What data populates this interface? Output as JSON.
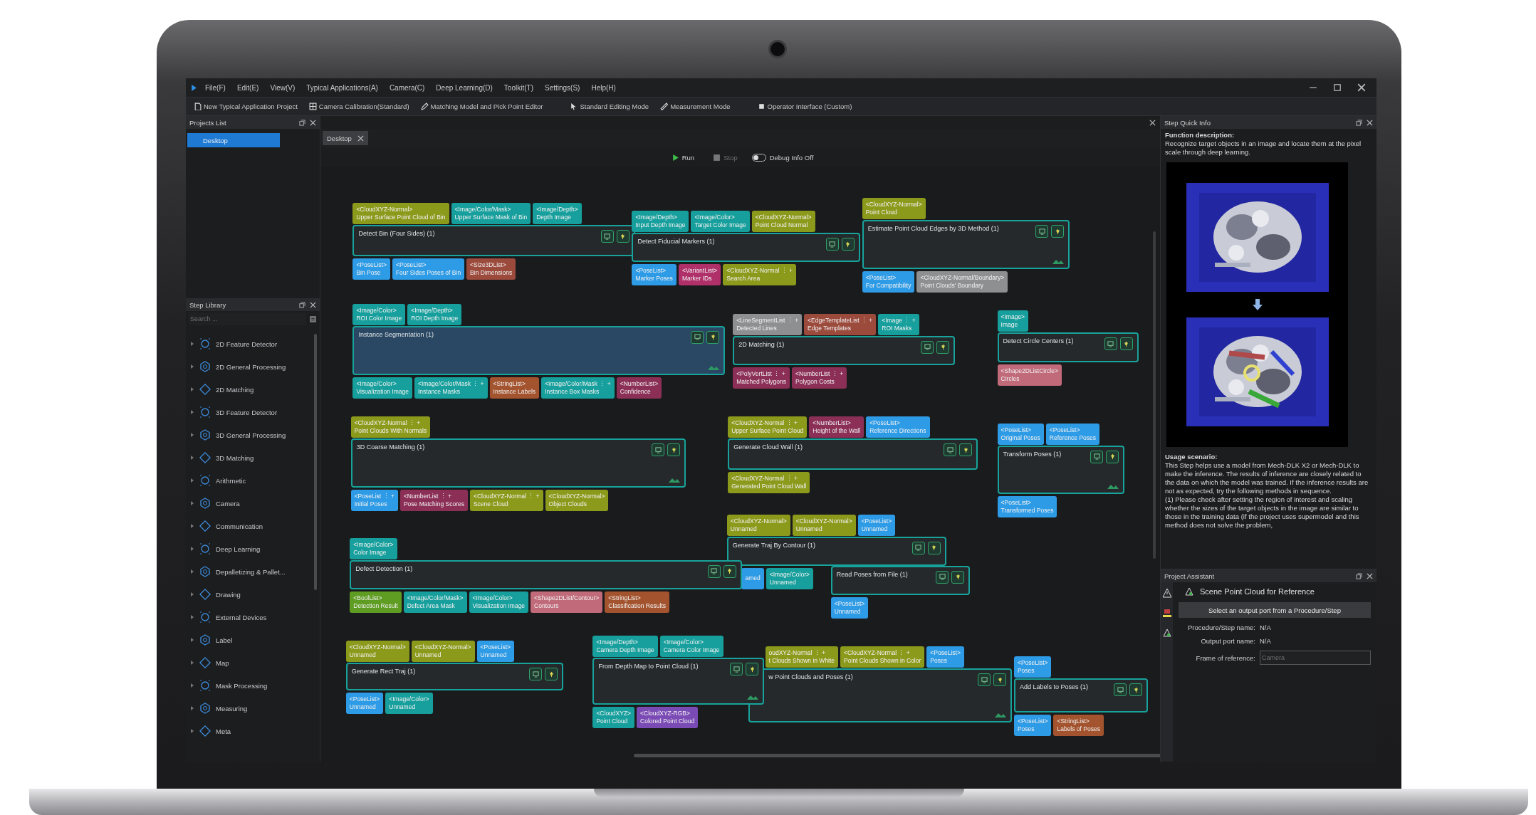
{
  "menu": [
    "File(F)",
    "Edit(E)",
    "View(V)",
    "Typical Applications(A)",
    "Camera(C)",
    "Deep Learning(D)",
    "Toolkit(T)",
    "Settings(S)",
    "Help(H)"
  ],
  "toolbar": [
    {
      "label": "New Typical Application Project",
      "kind": "project"
    },
    {
      "label": "Camera Calibration(Standard)",
      "kind": "calibration"
    },
    {
      "label": "Matching Model and Pick Point Editor",
      "kind": "editor"
    },
    {
      "label": "Standard Editing Mode",
      "kind": "mode"
    },
    {
      "label": "Measurement Mode",
      "kind": "measure"
    },
    {
      "label": "Operator Interface (Custom)",
      "kind": "interface"
    }
  ],
  "projects_list": {
    "title": "Projects List",
    "items": [
      {
        "label": "Desktop",
        "selected": true
      }
    ]
  },
  "step_library": {
    "title": "Step Library",
    "search": {
      "placeholder": "Search ..."
    },
    "items": [
      "2D Feature Detector",
      "2D General Processing",
      "2D Matching",
      "3D Feature Detector",
      "3D General Processing",
      "3D Matching",
      "Arithmetic",
      "Camera",
      "Communication",
      "Deep Learning",
      "Depalletizing & Pallet...",
      "Drawing",
      "External Devices",
      "Label",
      "Map",
      "Mask Processing",
      "Measuring",
      "Meta"
    ]
  },
  "editor": {
    "tab": {
      "label": "Desktop",
      "selected": true
    },
    "run": {
      "label": "Run",
      "disabled": false
    },
    "stop": {
      "label": "Stop",
      "disabled": true
    },
    "debug": {
      "label": "Debug Info Off",
      "on": false
    },
    "nodes": [
      {
        "title": "Detect Bin (Four Sides) (1)",
        "selected": false,
        "inputs": [
          {
            "type": "<CloudXYZ-Normal>",
            "name": "Upper Surface Point Cloud of Bin",
            "color": "#8c9a1c"
          },
          {
            "type": "<Image/Color/Mask>",
            "name": "Upper Surface Mask of Bin",
            "color": "#169f9c"
          },
          {
            "type": "<Image/Depth>",
            "name": "Depth Image",
            "color": "#169f9c"
          }
        ],
        "outputs": [
          {
            "type": "<PoseList>",
            "name": "Bin Pose",
            "color": "#2e9be6"
          },
          {
            "type": "<PoseList>",
            "name": "Four Sides Poses of Bin",
            "color": "#2e9be6"
          },
          {
            "type": "<Size3DList>",
            "name": "Bin Dimensions",
            "color": "#9b4a3c"
          }
        ]
      },
      {
        "title": "Detect Fiducial Markers (1)",
        "selected": false,
        "inputs": [
          {
            "type": "<Image/Depth>",
            "name": "Input Depth Image",
            "color": "#169f9c"
          },
          {
            "type": "<Image/Color>",
            "name": "Target Color Image",
            "color": "#169f9c"
          },
          {
            "type": "<CloudXYZ-Normal>",
            "name": "Point Cloud Normal",
            "color": "#8c9a1c"
          }
        ],
        "outputs": [
          {
            "type": "<PoseList>",
            "name": "Marker Poses",
            "color": "#2e9be6"
          },
          {
            "type": "<VariantList>",
            "name": "Marker IDs",
            "color": "#b0306a"
          },
          {
            "type": "<CloudXYZ-Normal ⋮ +",
            "name": "Search Area",
            "color": "#8c9a1c"
          }
        ]
      },
      {
        "title": "Estimate Point Cloud Edges by 3D Method (1)",
        "selected": false,
        "inputs": [
          {
            "type": "<CloudXYZ-Normal>",
            "name": "Point Cloud",
            "color": "#8c9a1c"
          }
        ],
        "outputs": [
          {
            "type": "<PoseList>",
            "name": "For Compatibility",
            "color": "#2e9be6"
          },
          {
            "type": "<CloudXYZ-Normal/Boundary>",
            "name": "Point Clouds' Boundary",
            "color": "#8d8f90"
          }
        ]
      },
      {
        "title": "Instance Segmentation (1)",
        "selected": true,
        "inputs": [
          {
            "type": "<Image/Color>",
            "name": "ROI Color Image",
            "color": "#169f9c"
          },
          {
            "type": "<Image/Depth>",
            "name": "ROI Depth Image",
            "color": "#169f9c"
          }
        ],
        "outputs": [
          {
            "type": "<Image/Color>",
            "name": "Visualization Image",
            "color": "#169f9c"
          },
          {
            "type": "<Image/Color/Mask ⋮ +",
            "name": "Instance Masks",
            "color": "#169f9c"
          },
          {
            "type": "<StringList>",
            "name": "Instance Labels",
            "color": "#a3532d"
          },
          {
            "type": "<Image/Color/Mask ⋮ +",
            "name": "Instance Box Masks",
            "color": "#169f9c"
          },
          {
            "type": "<NumberList>",
            "name": "Confidence",
            "color": "#8b2f57"
          }
        ]
      },
      {
        "title": "2D Matching (1)",
        "selected": false,
        "inputs": [
          {
            "type": "<LineSegmentList ⋮ +",
            "name": "Detected Lines",
            "color": "#8d8f90"
          },
          {
            "type": "<EdgeTemplateList ⋮ +",
            "name": "Edge Templates",
            "color": "#9b4a3c"
          },
          {
            "type": "<Image ⋮ +",
            "name": "ROI Masks",
            "color": "#169f9c"
          }
        ],
        "outputs": [
          {
            "type": "<PolyVertList ⋮ +",
            "name": "Matched Polygons",
            "color": "#8b2f57"
          },
          {
            "type": "<NumberList ⋮ +",
            "name": "Polygon Costs",
            "color": "#8b2f57"
          }
        ]
      },
      {
        "title": "Detect Circle Centers (1)",
        "selected": false,
        "inputs": [
          {
            "type": "<Image>",
            "name": "Image",
            "color": "#169f9c"
          }
        ],
        "outputs": [
          {
            "type": "<Shape2DListCircle>",
            "name": "Circles",
            "color": "#c06a7a"
          }
        ]
      },
      {
        "title": "3D Coarse Matching (1)",
        "selected": false,
        "inputs": [
          {
            "type": "<CloudXYZ-Normal ⋮ +",
            "name": "Point Clouds With Normals",
            "color": "#8c9a1c"
          }
        ],
        "outputs": [
          {
            "type": "<PoseList ⋮ +",
            "name": "Initial Poses",
            "color": "#2e9be6"
          },
          {
            "type": "<NumberList ⋮ +",
            "name": "Pose Matching Scores",
            "color": "#8b2f57"
          },
          {
            "type": "<CloudXYZ-Normal ⋮ +",
            "name": "Scene Cloud",
            "color": "#8c9a1c"
          },
          {
            "type": "<CloudXYZ-Normal>",
            "name": "Object Clouds",
            "color": "#8c9a1c"
          }
        ]
      },
      {
        "title": "Generate Cloud Wall (1)",
        "selected": false,
        "inputs": [
          {
            "type": "<CloudXYZ-Normal ⋮ +",
            "name": "Upper Surface Point Cloud",
            "color": "#8c9a1c"
          },
          {
            "type": "<NumberList>",
            "name": "Height of the Wall",
            "color": "#8b2f57"
          },
          {
            "type": "<PoseList>",
            "name": "Reference Directions",
            "color": "#2e9be6"
          }
        ],
        "outputs": [
          {
            "type": "<CloudXYZ-Normal ⋮ +",
            "name": "Generated Point Cloud Wall",
            "color": "#8c9a1c"
          }
        ]
      },
      {
        "title": "Transform Poses (1)",
        "selected": false,
        "inputs": [
          {
            "type": "<PoseList>",
            "name": "Original Poses",
            "color": "#2e9be6"
          },
          {
            "type": "<PoseList>",
            "name": "Reference Poses",
            "color": "#2e9be6"
          }
        ],
        "outputs": [
          {
            "type": "<PoseList>",
            "name": "Transformed Poses",
            "color": "#2e9be6"
          }
        ]
      },
      {
        "title": "Defect Detection (1)",
        "selected": false,
        "inputs": [
          {
            "type": "<Image/Color>",
            "name": "Color Image",
            "color": "#169f9c"
          }
        ],
        "outputs": [
          {
            "type": "<BoolList>",
            "name": "Detection Result",
            "color": "#5e9c22"
          },
          {
            "type": "<Image/Color/Mask>",
            "name": "Defect Area Mask",
            "color": "#169f9c"
          },
          {
            "type": "<Image/Color>",
            "name": "Visualization Image",
            "color": "#169f9c"
          },
          {
            "type": "<Shape2DList/Contour>",
            "name": "Contours",
            "color": "#c06a7a"
          },
          {
            "type": "<StringList>",
            "name": "Classification Results",
            "color": "#a3532d"
          }
        ]
      },
      {
        "title": "Generate Traj By Contour (1)",
        "selected": false,
        "inputs": [
          {
            "type": "<CloudXYZ-Normal>",
            "name": "Unnamed",
            "color": "#8c9a1c"
          },
          {
            "type": "<CloudXYZ-Normal>",
            "name": "Unnamed",
            "color": "#8c9a1c"
          },
          {
            "type": "<PoseList>",
            "name": "Unnamed",
            "color": "#2e9be6"
          }
        ],
        "outputs": [
          {
            "name": "amed",
            "color": "#2e9be6"
          },
          {
            "type": "<Image/Color>",
            "name": "Unnamed",
            "color": "#169f9c"
          }
        ]
      },
      {
        "title": "Read Poses from File (1)",
        "selected": false,
        "outputs": [
          {
            "type": "<PoseList>",
            "name": "Unnamed",
            "color": "#2e9be6"
          }
        ]
      },
      {
        "title": "Generate Rect Traj (1)",
        "selected": false,
        "inputs": [
          {
            "type": "<CloudXYZ-Normal>",
            "name": "Unnamed",
            "color": "#8c9a1c"
          },
          {
            "type": "<CloudXYZ-Normal>",
            "name": "Unnamed",
            "color": "#8c9a1c"
          },
          {
            "type": "<PoseList>",
            "name": "Unnamed",
            "color": "#2e9be6"
          }
        ],
        "outputs": [
          {
            "type": "<PoseList>",
            "name": "Unnamed",
            "color": "#2e9be6"
          },
          {
            "type": "<Image/Color>",
            "name": "Unnamed",
            "color": "#169f9c"
          }
        ]
      },
      {
        "title": "From Depth Map to Point Cloud (1)",
        "selected": false,
        "inputs": [
          {
            "type": "<Image/Depth>",
            "name": "Camera Depth Image",
            "color": "#169f9c"
          },
          {
            "type": "<Image/Color>",
            "name": "Camera Color Image",
            "color": "#169f9c"
          }
        ],
        "outputs": [
          {
            "type": "<CloudXYZ>",
            "name": "Point Cloud",
            "color": "#169f9c"
          },
          {
            "type": "<CloudXYZ-RGB>",
            "name": "Colored Point Cloud",
            "color": "#7b4bb5"
          }
        ]
      },
      {
        "title": "w Point Clouds and Poses (1)",
        "selected": false,
        "inputs": [
          {
            "type": "oudXYZ-Normal ⋮ +",
            "name": "t Clouds Shown in White",
            "color": "#8c9a1c"
          },
          {
            "type": "<CloudXYZ-Normal ⋮ +",
            "name": "Point Clouds Shown in Color",
            "color": "#8c9a1c"
          },
          {
            "type": "<PoseList>",
            "name": "Poses",
            "color": "#2e9be6"
          }
        ]
      },
      {
        "title": "Add Labels to Poses (1)",
        "selected": false,
        "inputs": [
          {
            "type": "<PoseList>",
            "name": "Poses",
            "color": "#2e9be6"
          }
        ],
        "outputs": [
          {
            "type": "<PoseList>",
            "name": "Poses",
            "color": "#2e9be6"
          },
          {
            "type": "<StringList>",
            "name": "Labels of Poses",
            "color": "#a3532d"
          }
        ]
      }
    ]
  },
  "step_quick_info": {
    "title": "Step Quick Info",
    "function_heading": "Function description:",
    "function_text": "Recognize target objects in an image and locate them at the pixel scale through deep learning.",
    "usage_heading": "Usage scenario:",
    "usage_text": [
      "This Step helps use a model from Mech-DLK X2 or Mech-DLK to make the inference. The results of inference are closely related to the data on which the model was trained. If the inference results are not as expected, try the following methods in sequence.",
      "(1) Please check after setting the region of interest and scaling whether the sizes of the target objects in the image are similar to those in the training data (if the project uses supermodel and this method does not solve the problem,"
    ]
  },
  "project_assistant": {
    "title": "Project Assistant",
    "heading": "Scene Point Cloud for Reference",
    "button": "Select an output port from a Procedure/Step",
    "fields": [
      {
        "label": "Procedure/Step name:",
        "value": "N/A"
      },
      {
        "label": "Output port name:",
        "value": "N/A"
      }
    ],
    "frame": {
      "label": "Frame of reference:",
      "placeholder": "Camera"
    }
  }
}
